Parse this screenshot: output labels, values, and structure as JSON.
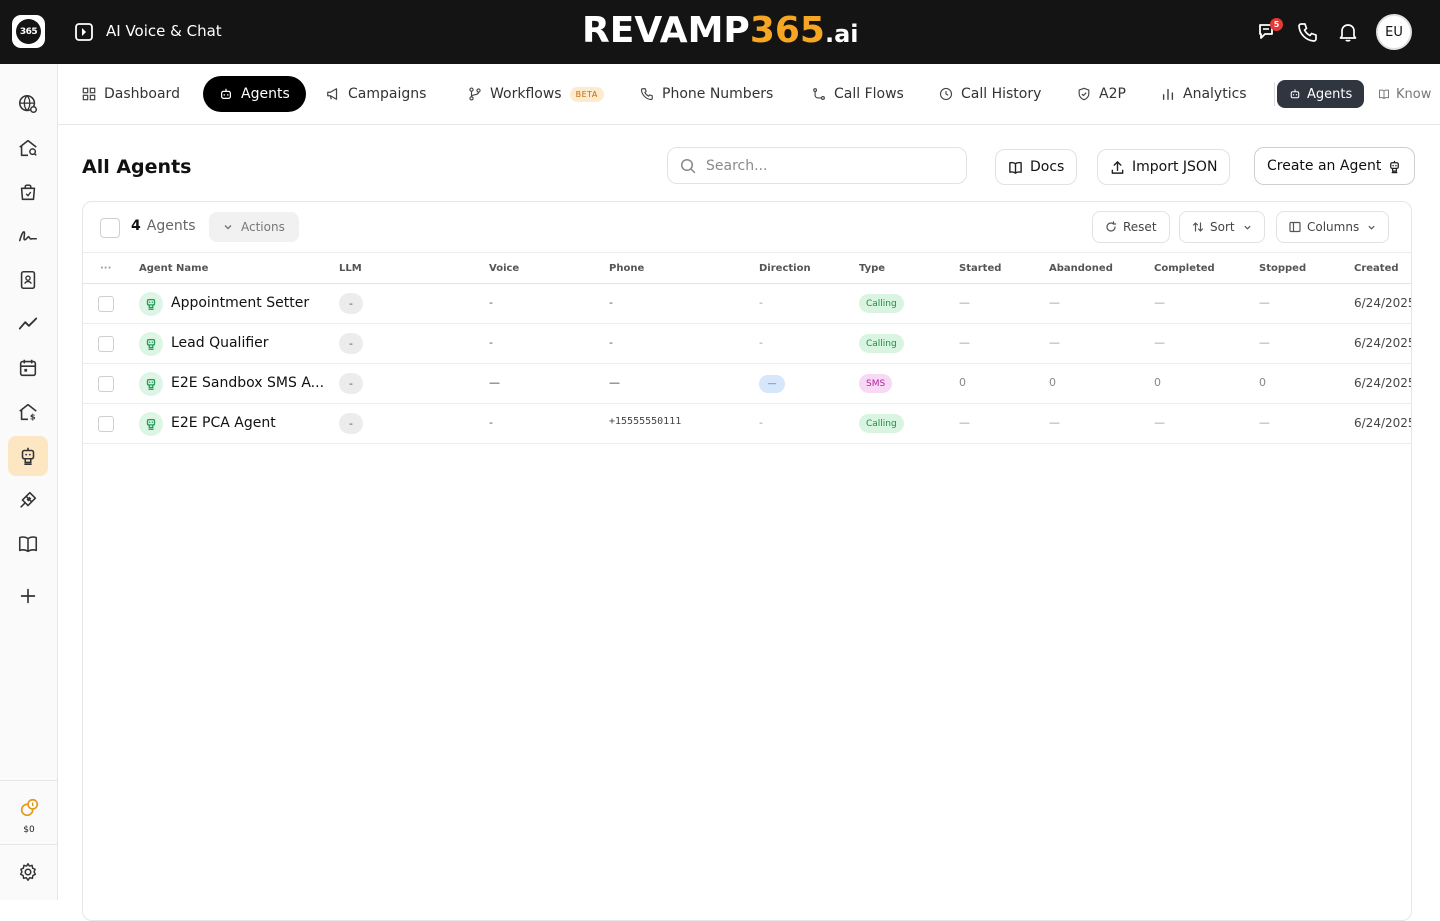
{
  "app": {
    "title": "AI Voice & Chat",
    "logo_text": "365",
    "brand": {
      "part1": "REVAMP",
      "part2": "365",
      "part3": ".ai"
    },
    "notifications_badge": "5",
    "avatar_initials": "EU"
  },
  "nav": {
    "tabs": [
      {
        "label": "Dashboard",
        "icon": "grid-icon"
      },
      {
        "label": "Agents",
        "icon": "robot-icon",
        "active": true
      },
      {
        "label": "Campaigns",
        "icon": "megaphone-icon"
      },
      {
        "label": "Workflows",
        "icon": "branch-icon",
        "badge": "BETA"
      },
      {
        "label": "Phone Numbers",
        "icon": "phone-icon"
      },
      {
        "label": "Call Flows",
        "icon": "flow-icon"
      },
      {
        "label": "Call History",
        "icon": "clock-icon"
      },
      {
        "label": "A2P",
        "icon": "shield-icon"
      },
      {
        "label": "Analytics",
        "icon": "bar-chart-icon"
      },
      {
        "label": "Agents",
        "icon": "robot-icon"
      },
      {
        "label": "Know",
        "icon": "book-icon"
      }
    ]
  },
  "sidebar": {
    "wallet_amount": "$0"
  },
  "page": {
    "title": "All Agents",
    "search_placeholder": "Search...",
    "docs_label": "Docs",
    "import_label": "Import JSON",
    "create_label": "Create an Agent"
  },
  "table": {
    "count": "4",
    "count_label": "Agents",
    "actions_label": "Actions",
    "reset_label": "Reset",
    "sort_label": "Sort",
    "columns_label": "Columns",
    "headers": {
      "menu": "···",
      "name": "Agent Name",
      "llm": "LLM",
      "voice": "Voice",
      "phone": "Phone",
      "direction": "Direction",
      "type": "Type",
      "started": "Started",
      "abandoned": "Abandoned",
      "completed": "Completed",
      "stopped": "Stopped",
      "created": "Created"
    },
    "rows": [
      {
        "name": "Appointment Setter",
        "llm": "-",
        "voice": "-",
        "phone": "-",
        "direction": "-",
        "type": "Calling",
        "started": "—",
        "abandoned": "—",
        "completed": "—",
        "stopped": "—",
        "created": "6/24/2025"
      },
      {
        "name": "Lead Qualifier",
        "llm": "-",
        "voice": "-",
        "phone": "-",
        "direction": "-",
        "type": "Calling",
        "started": "—",
        "abandoned": "—",
        "completed": "—",
        "stopped": "—",
        "created": "6/24/2025"
      },
      {
        "name": "E2E Sandbox SMS A...",
        "llm": "-",
        "voice": "—",
        "phone": "—",
        "direction": "—",
        "type": "SMS",
        "started": "0",
        "abandoned": "0",
        "completed": "0",
        "stopped": "0",
        "created": "6/24/2025"
      },
      {
        "name": "E2E PCA Agent",
        "llm": "-",
        "voice": "-",
        "phone": "+15555550111",
        "direction": "-",
        "type": "Calling",
        "started": "—",
        "abandoned": "—",
        "completed": "—",
        "stopped": "—",
        "created": "6/24/2025"
      }
    ]
  },
  "colors": {
    "topbar": "#141414",
    "accent": "#f5a623",
    "sidebar_active": "#fde7c3",
    "calling_badge": "#d9f5e2",
    "sms_badge": "#f7d9f3"
  }
}
